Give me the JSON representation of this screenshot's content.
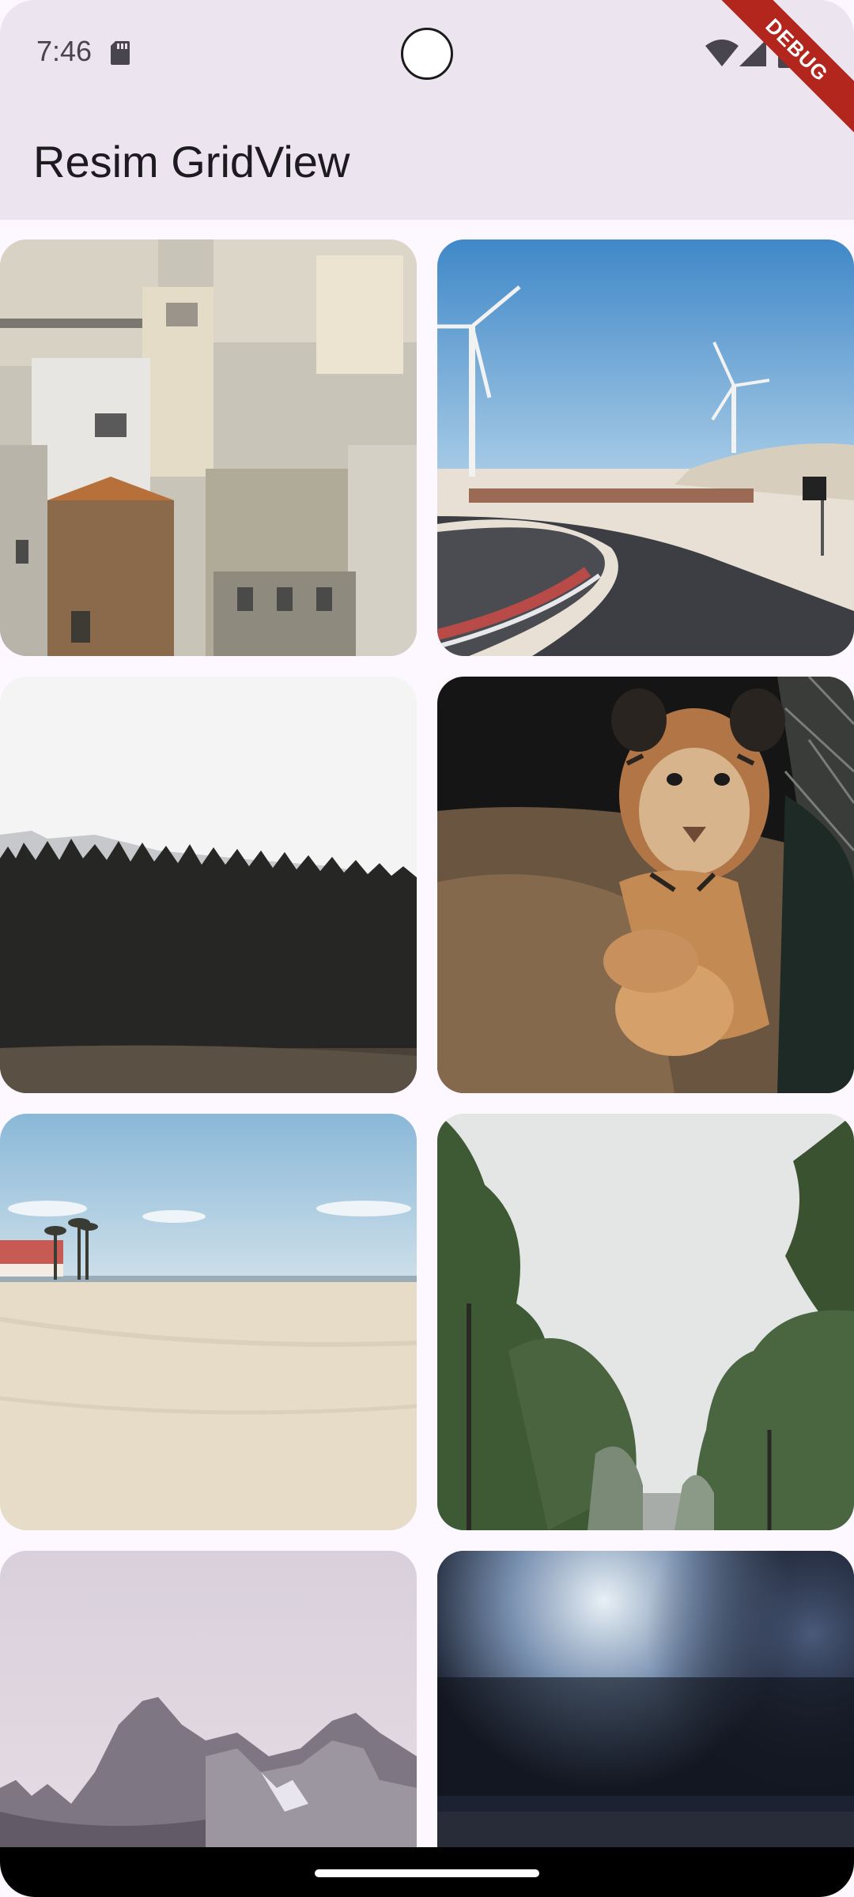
{
  "status_bar": {
    "time": "7:46",
    "icons": [
      "sd-card-icon",
      "camera-cutout",
      "wifi-icon",
      "cell-signal-icon",
      "battery-icon"
    ]
  },
  "debug_banner": {
    "label": "DEBUG"
  },
  "app_bar": {
    "title": "Resim GridView"
  },
  "grid": {
    "columns": 2,
    "images": [
      {
        "name": "city-houses-image"
      },
      {
        "name": "wind-turbines-road-image"
      },
      {
        "name": "pine-forest-image"
      },
      {
        "name": "tiger-cub-image"
      },
      {
        "name": "sandy-beach-image"
      },
      {
        "name": "foggy-trees-image"
      },
      {
        "name": "mountain-peaks-image"
      },
      {
        "name": "blurry-light-image"
      }
    ]
  },
  "colors": {
    "app_bar_bg": "#ece5f0",
    "page_bg": "#fdf7ff",
    "debug_red": "#b3261e"
  }
}
